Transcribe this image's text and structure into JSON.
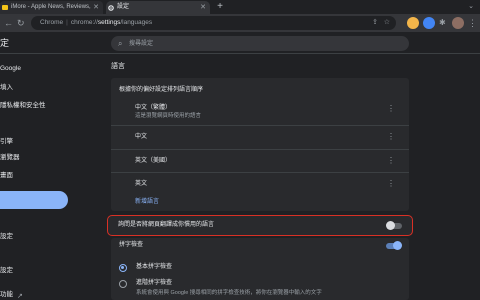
{
  "tabs": [
    {
      "title": "iMore - Apple News, Reviews,",
      "state": "inactive"
    },
    {
      "title": "設定",
      "state": "active"
    }
  ],
  "new_tab": "+",
  "tab_close": "✕",
  "omnibox": {
    "scheme": "Chrome",
    "separator": "|",
    "host_path_prefix": "chrome://",
    "host": "settings",
    "path": "/languages"
  },
  "settings": {
    "title": "定",
    "search_placeholder": "搜尋設定"
  },
  "nav": {
    "items": [
      {
        "label": "Google"
      },
      {
        "label": "填入"
      },
      {
        "label": "隱私權和安全性"
      },
      {
        "label": "引擎"
      },
      {
        "label": "瀏覽器"
      },
      {
        "label": "畫面"
      },
      {
        "label": "設定"
      },
      {
        "label": "設定"
      },
      {
        "label": "功能"
      }
    ]
  },
  "languages": {
    "section_title": "語言",
    "order_heading": "根據你的偏好設定排列語言順序",
    "list": [
      {
        "name": "中文（繁體）",
        "description": "這是瀏覽網頁時使用的語言"
      },
      {
        "name": "中文",
        "description": ""
      },
      {
        "name": "英文（美國）",
        "description": ""
      },
      {
        "name": "英文",
        "description": ""
      }
    ],
    "more_glyph": "⋮",
    "add_language": "新增語言",
    "offer_translate": {
      "label": "詢問是否將網頁翻譯成你慣用的語言",
      "enabled": false
    }
  },
  "spellcheck": {
    "label": "拼字檢查",
    "enabled": true,
    "options": [
      {
        "label": "基本拼字檢查",
        "selected": true,
        "description": ""
      },
      {
        "label": "進階拼字檢查",
        "selected": false,
        "description": "系統會使用與 Google 搜尋相同的拼字檢查技術，將你在瀏覽器中輸入的文字"
      }
    ]
  },
  "colors": {
    "accent": "#8ab4f8",
    "highlight_border": "#d93025",
    "background": "#202124",
    "card": "#292a2d"
  }
}
